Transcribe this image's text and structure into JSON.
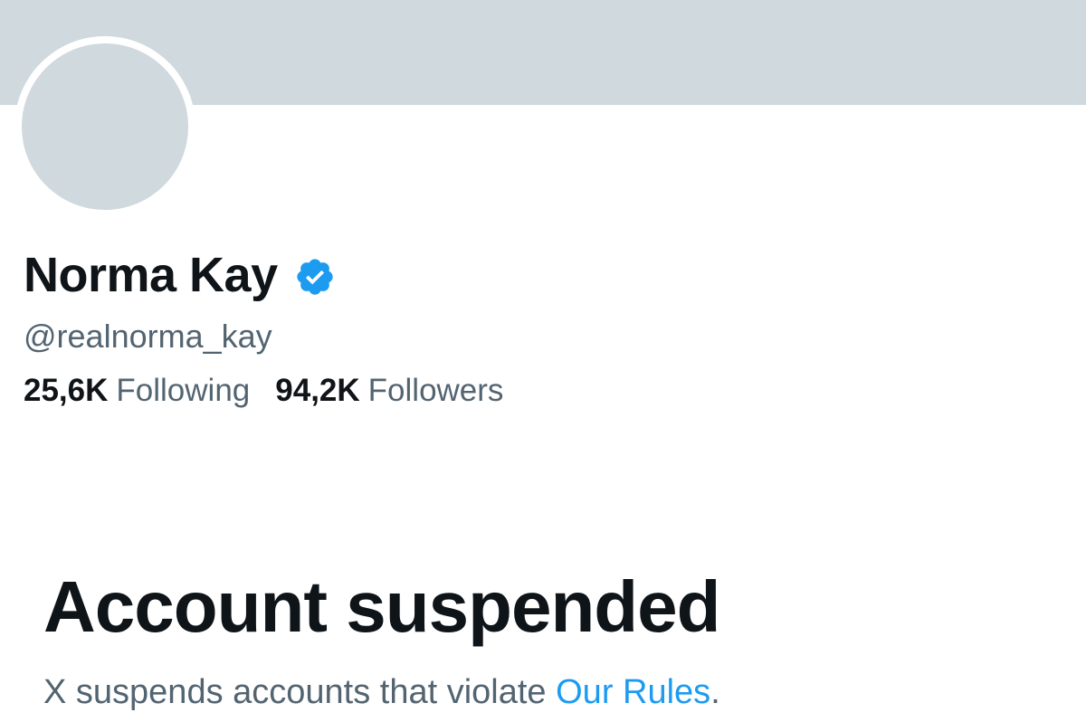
{
  "profile": {
    "display_name": "Norma Kay",
    "verified_icon": "verified-badge-icon",
    "handle": "@realnorma_kay",
    "following_count": "25,6K",
    "following_label": "Following",
    "followers_count": "94,2K",
    "followers_label": "Followers"
  },
  "suspension": {
    "title": "Account suspended",
    "message_prefix": "X suspends accounts that violate ",
    "rules_link": "Our Rules",
    "message_suffix": "."
  },
  "colors": {
    "banner": "#cfd9de",
    "avatar_placeholder": "#cfd9de",
    "primary_text": "#0f1419",
    "secondary_text": "#536471",
    "accent": "#1d9bf0"
  }
}
